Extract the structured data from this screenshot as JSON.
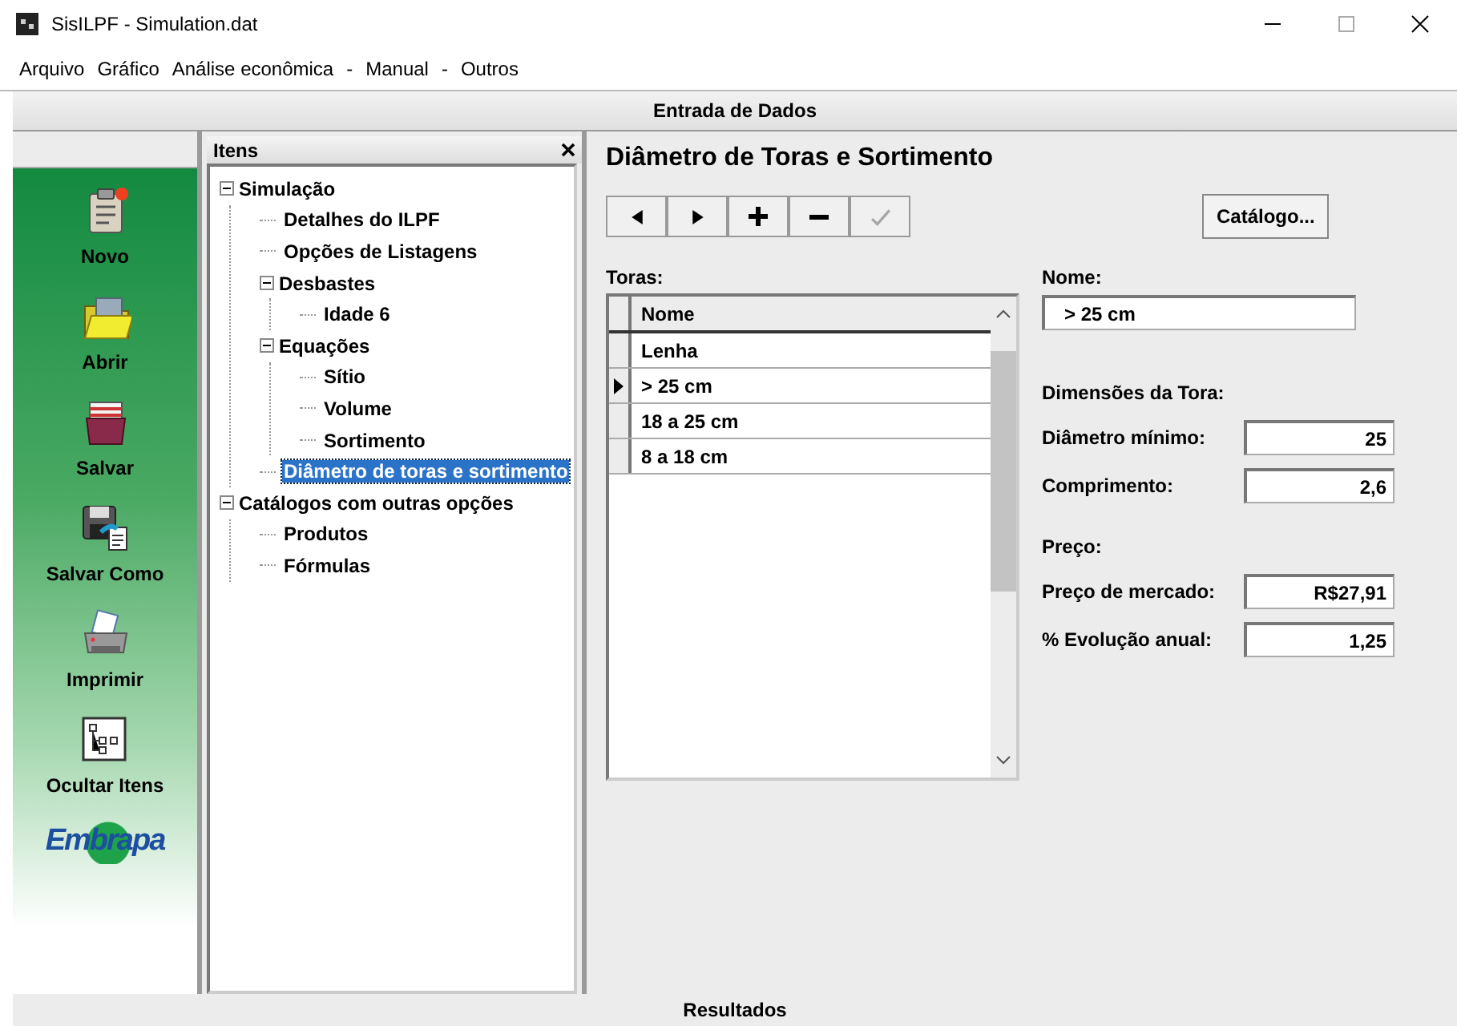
{
  "window": {
    "title": "SisILPF - Simulation.dat"
  },
  "menu": [
    {
      "label": "Arquivo"
    },
    {
      "label": "Gráfico"
    },
    {
      "label": "Análise econômica"
    },
    {
      "label": "-"
    },
    {
      "label": "Manual"
    },
    {
      "label": "-"
    },
    {
      "label": "Outros"
    }
  ],
  "header": "Entrada de Dados",
  "sidebar": {
    "buttons": [
      {
        "label": "Novo",
        "kind": "new"
      },
      {
        "label": "Abrir",
        "kind": "open"
      },
      {
        "label": "Salvar",
        "kind": "save"
      },
      {
        "label": "Salvar Como",
        "kind": "saveas"
      },
      {
        "label": "Imprimir",
        "kind": "print"
      },
      {
        "label": "Ocultar Itens",
        "kind": "tree"
      }
    ],
    "logo": "Embrapa"
  },
  "tree": {
    "title": "Itens",
    "items": [
      {
        "label": "Simulação",
        "expanded": true,
        "selected": false,
        "children": [
          {
            "label": "Detalhes do ILPF",
            "selected": false
          },
          {
            "label": "Opções de Listagens",
            "selected": false
          },
          {
            "label": "Desbastes",
            "expanded": true,
            "selected": false,
            "children": [
              {
                "label": "Idade 6",
                "selected": false
              }
            ]
          },
          {
            "label": "Equações",
            "expanded": true,
            "selected": false,
            "children": [
              {
                "label": "Sítio",
                "selected": false
              },
              {
                "label": "Volume",
                "selected": false
              },
              {
                "label": "Sortimento",
                "selected": false
              }
            ]
          },
          {
            "label": "Diâmetro de toras e sortimento",
            "selected": true
          }
        ]
      },
      {
        "label": "Catálogos com outras opções",
        "expanded": true,
        "selected": false,
        "children": [
          {
            "label": "Produtos",
            "selected": false
          },
          {
            "label": "Fórmulas",
            "selected": false
          }
        ]
      }
    ]
  },
  "detail": {
    "title": "Diâmetro de Toras e Sortimento",
    "toolbar": [
      {
        "kind": "prev",
        "disabled": false
      },
      {
        "kind": "next",
        "disabled": false
      },
      {
        "kind": "add",
        "disabled": false
      },
      {
        "kind": "remove",
        "disabled": false
      },
      {
        "kind": "confirm",
        "disabled": true
      }
    ],
    "catalog_button": "Catálogo...",
    "list": {
      "label": "Toras:",
      "column": "Nome",
      "rows": [
        {
          "name": "Lenha",
          "selected": false
        },
        {
          "name": "> 25 cm",
          "selected": true
        },
        {
          "name": "18 a 25 cm",
          "selected": false
        },
        {
          "name": "8 a 18 cm",
          "selected": false
        }
      ]
    },
    "name_field": {
      "label": "Nome:",
      "value": "> 25 cm"
    },
    "sections": [
      {
        "title": "Dimensões da Tora:",
        "fields": [
          {
            "label": "Diâmetro mínimo:",
            "value": "25"
          },
          {
            "label": "Comprimento:",
            "value": "2,6"
          }
        ]
      },
      {
        "title": "Preço:",
        "fields": [
          {
            "label": "Preço de mercado:",
            "value": "R$27,91"
          },
          {
            "label": "% Evolução anual:",
            "value": "1,25"
          }
        ]
      }
    ]
  },
  "footer": "Resultados"
}
